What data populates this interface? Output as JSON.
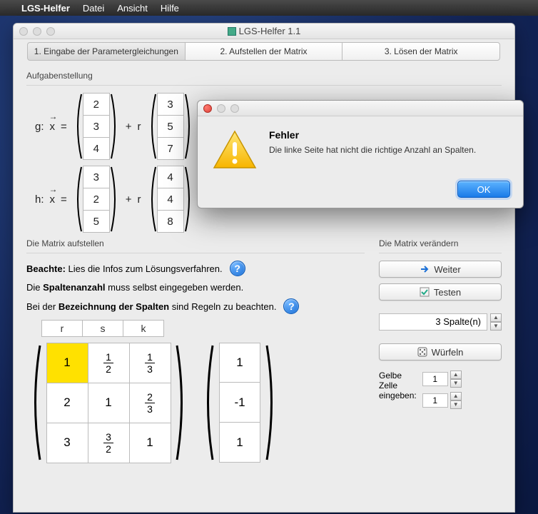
{
  "menubar": {
    "appname": "LGS-Helfer",
    "items": [
      "Datei",
      "Ansicht",
      "Hilfe"
    ]
  },
  "window": {
    "title": "LGS-Helfer 1.1"
  },
  "tabs": [
    {
      "label": "1. Eingabe der Parametergleichungen",
      "active": true
    },
    {
      "label": "2. Aufstellen der Matrix",
      "active": false
    },
    {
      "label": "3. Lösen der Matrix",
      "active": false
    }
  ],
  "task": {
    "heading": "Aufgabenstellung"
  },
  "eq": {
    "g": {
      "label": "g:",
      "p": [
        "2",
        "3",
        "4"
      ],
      "r": "r",
      "d": [
        "3",
        "5",
        "7"
      ]
    },
    "h": {
      "label": "h:",
      "p": [
        "3",
        "2",
        "5"
      ],
      "r": "r",
      "d": [
        "4",
        "4",
        "8"
      ]
    },
    "x": "x",
    "eq": "=",
    "plus": "+"
  },
  "matrix_setup": {
    "heading": "Die Matrix aufstellen",
    "beachte_b": "Beachte:",
    "beachte_t": " Lies die Infos zum Lösungsverfahren.",
    "line2a": "Die ",
    "line2b": "Spaltenanzahl",
    "line2c": " muss selbst eingegeben werden.",
    "line3a": "Bei der ",
    "line3b": "Bezeichnung der Spalten",
    "line3c": " sind Regeln zu beachten.",
    "col_labels": [
      "r",
      "s",
      "k"
    ],
    "grid": [
      [
        "1",
        "1/2",
        "1/3"
      ],
      [
        "2",
        "1",
        "2/3"
      ],
      [
        "3",
        "3/2",
        "1"
      ]
    ],
    "rhs": [
      "1",
      "-1",
      "1"
    ],
    "highlight": [
      0,
      0
    ]
  },
  "sidepanel": {
    "heading": "Die Matrix verändern",
    "weiter": "Weiter",
    "testen": "Testen",
    "spalten_label": "3 Spalte(n)",
    "wuerfeln": "Würfeln",
    "gelbe_label": "Gelbe\nZelle\neingeben:",
    "gelbe_vals": [
      "1",
      "1"
    ]
  },
  "dialog": {
    "title": "Fehler",
    "message": "Die linke Seite hat nicht die richtige Anzahl an Spalten.",
    "ok": "OK"
  }
}
